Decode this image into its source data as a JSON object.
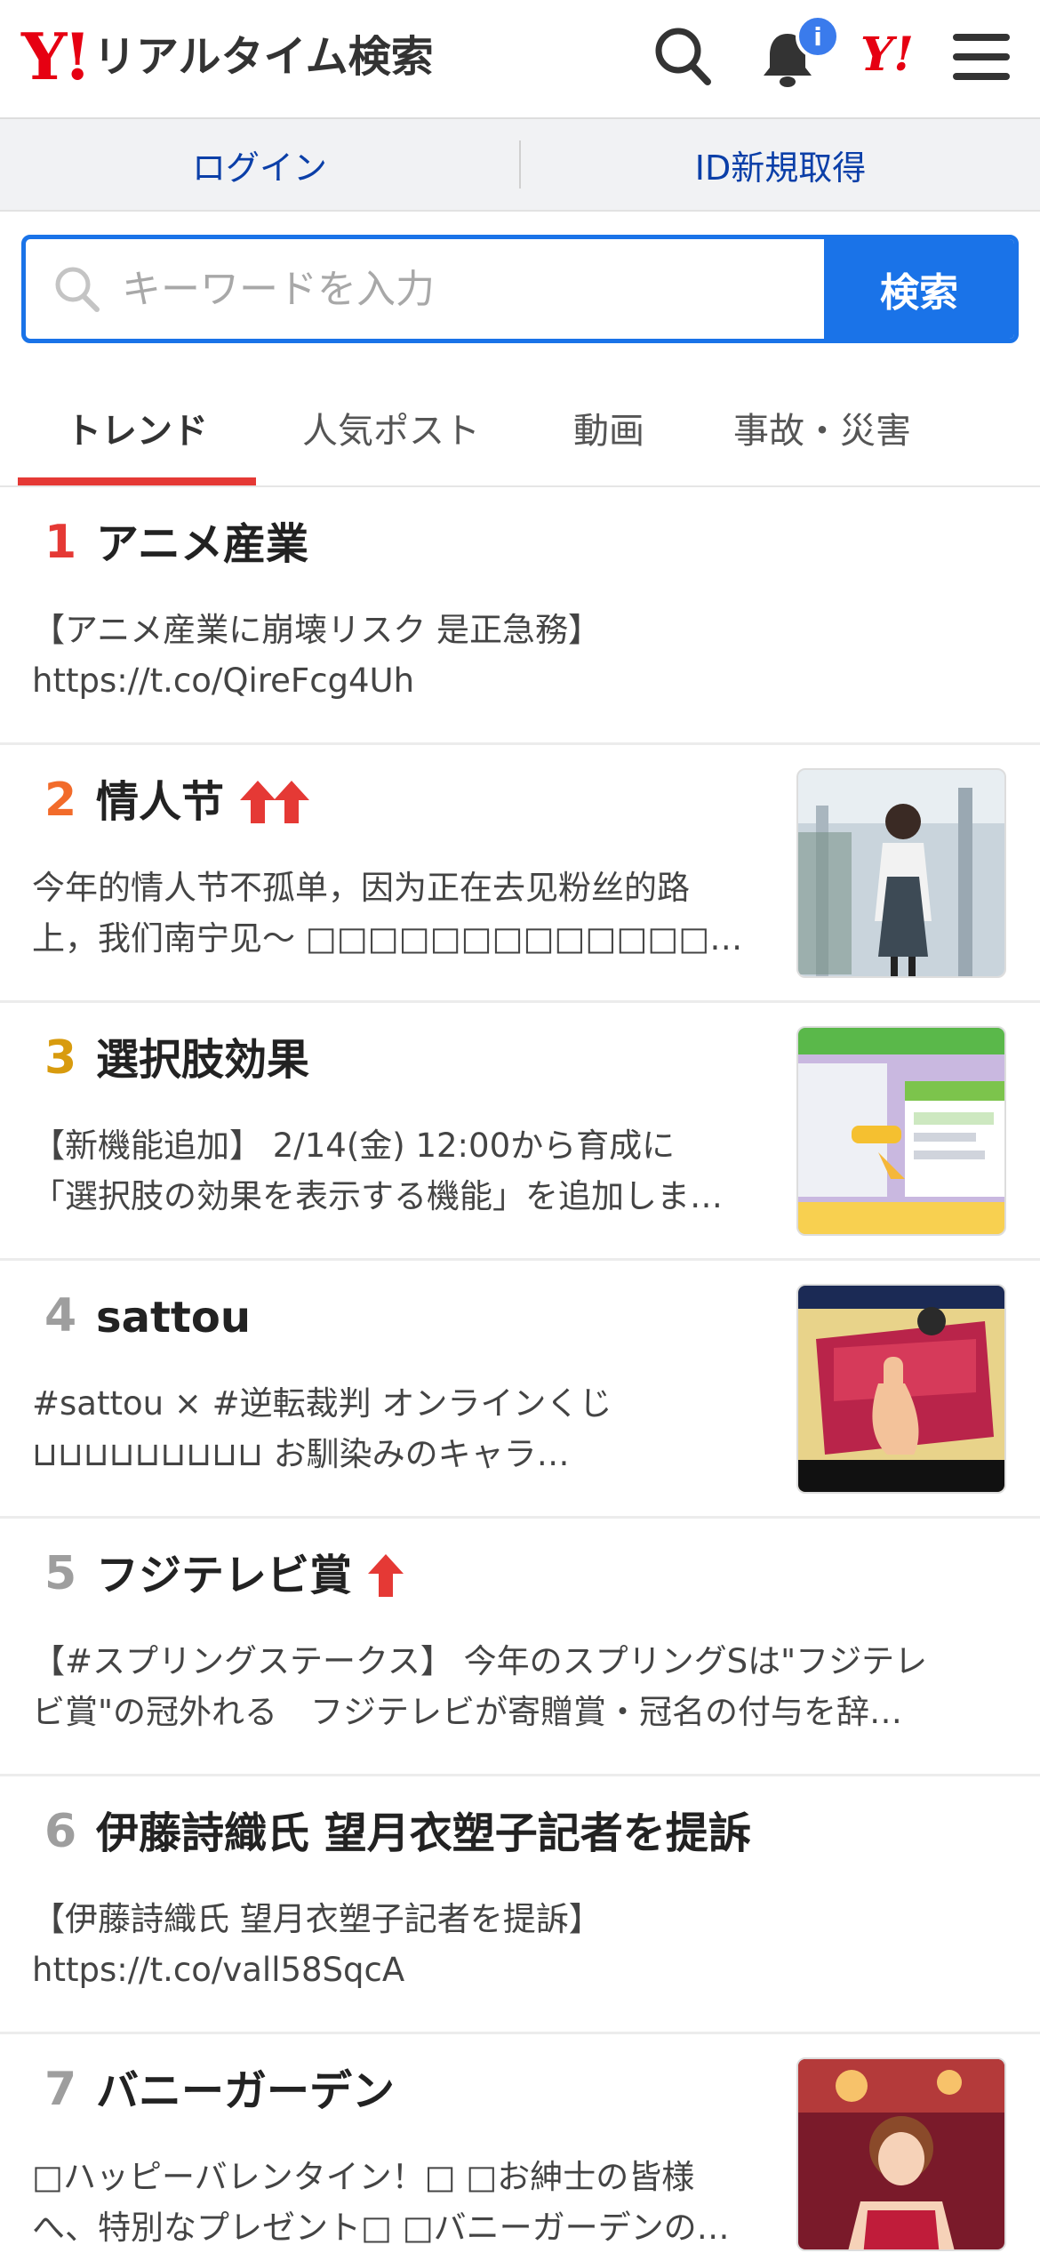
{
  "header": {
    "logo_mark": "Y!",
    "logo_text": "リアルタイム検索",
    "notification_badge": "i",
    "yahoo_logo": "Y!",
    "icons": [
      "search-icon",
      "bell-icon",
      "yahoo-japan-icon",
      "menu-icon"
    ]
  },
  "login_bar": {
    "login": "ログイン",
    "register": "ID新規取得"
  },
  "search": {
    "placeholder": "キーワードを入力",
    "button": "検索"
  },
  "tabs": [
    {
      "label": "トレンド",
      "active": true
    },
    {
      "label": "人気ポスト",
      "active": false
    },
    {
      "label": "動画",
      "active": false
    },
    {
      "label": "事故・災害",
      "active": false
    }
  ],
  "colors": {
    "brand_red": "#e60012",
    "accent_blue": "#1a73e8",
    "link_blue": "#0b3fa8",
    "rank1": "#e53935",
    "rank2": "#f26b2a",
    "rank3": "#d89b0e",
    "rank_gray": "#9e9e9e"
  },
  "trends": [
    {
      "rank": "1",
      "title": "アニメ産業",
      "arrows": 0,
      "lines": [
        "【アニメ産業に崩壊リスク 是正急務】",
        "https://t.co/QireFcg4Uh"
      ],
      "thumb": null
    },
    {
      "rank": "2",
      "title": "情人节",
      "arrows": 2,
      "lines": [
        "今年的情人节不孤单，因为正在去见粉丝的路",
        "上，我们南宁见〜 □□□□□□□□□□□□□□□□□□□□□□…"
      ],
      "thumb": "airport-photo"
    },
    {
      "rank": "3",
      "title": "選択肢効果",
      "arrows": 0,
      "lines": [
        "【新機能追加】 2/14(金) 12:00から育成に",
        "「選択肢の効果を表示する機能」を追加しま…"
      ],
      "thumb": "game-screenshot"
    },
    {
      "rank": "4",
      "title": "sattou",
      "arrows": 0,
      "lines": [
        "#sattou × #逆転裁判 オンラインくじ",
        "⊔⊔⊔⊔⊔⊔⊔⊔⊔ お馴染みのキャラ…"
      ],
      "thumb": "anime-illustration"
    },
    {
      "rank": "5",
      "title": "フジテレビ賞",
      "arrows": 1,
      "lines": [
        "【#スプリングステークス】 今年のスプリングSは\"フジテレ",
        "ビ賞\"の冠外れる　フジテレビが寄贈賞・冠名の付与を辞…"
      ],
      "thumb": null
    },
    {
      "rank": "6",
      "title": "伊藤詩織氏 望月衣塑子記者を提訴",
      "arrows": 0,
      "lines": [
        "【伊藤詩織氏 望月衣塑子記者を提訴】",
        "https://t.co/vall58SqcA"
      ],
      "thumb": null
    },
    {
      "rank": "7",
      "title": "バニーガーデン",
      "arrows": 0,
      "lines": [
        "□ハッピーバレンタイン！□ □お紳士の皆様",
        "へ、特別なプレゼント□ □バニーガーデンの…"
      ],
      "thumb": "bunny-garden-art"
    }
  ]
}
